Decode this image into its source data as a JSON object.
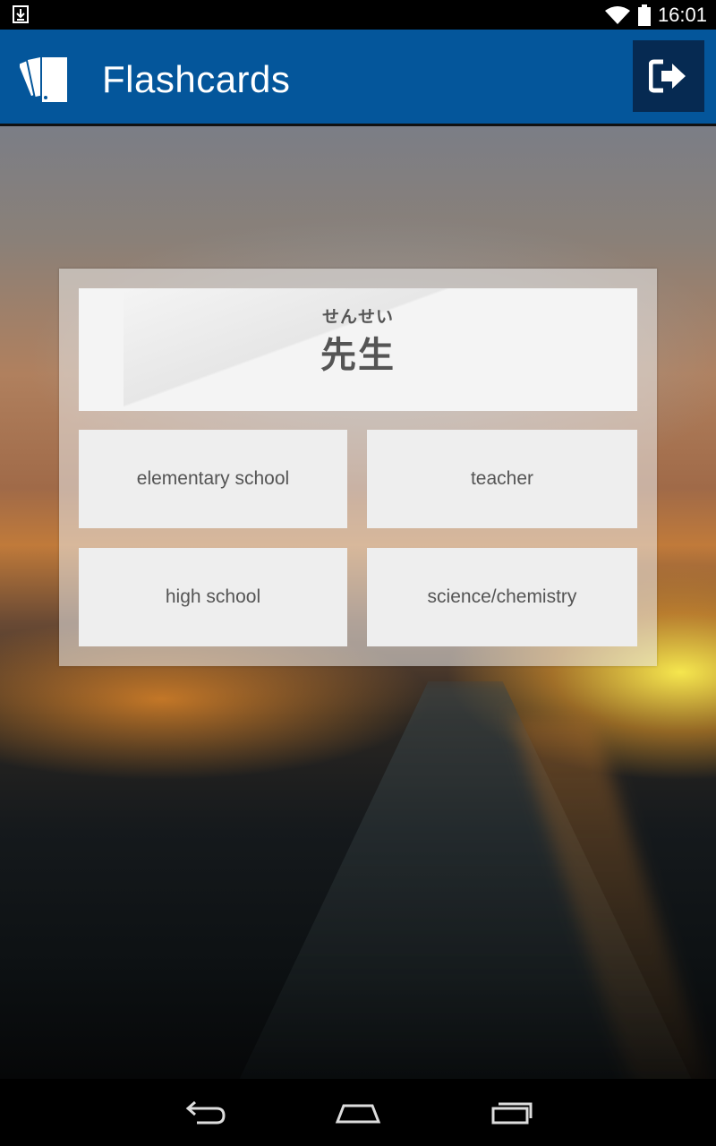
{
  "status_bar": {
    "time": "16:01",
    "icons": [
      "download-notification-icon",
      "wifi-icon",
      "battery-icon"
    ]
  },
  "app_bar": {
    "title": "Flashcards",
    "logo_icon": "flashcards-logo-icon",
    "exit_icon": "exit-arrow-icon",
    "colors": {
      "bar": "#04569b",
      "exit_button": "#062a52"
    }
  },
  "flashcard": {
    "reading": "せんせい",
    "term": "先生"
  },
  "answers": [
    {
      "label": "elementary school"
    },
    {
      "label": "teacher"
    },
    {
      "label": "high school"
    },
    {
      "label": "science/chemistry"
    }
  ],
  "nav_bar": {
    "icons": [
      "back-icon",
      "home-icon",
      "recent-apps-icon"
    ]
  }
}
